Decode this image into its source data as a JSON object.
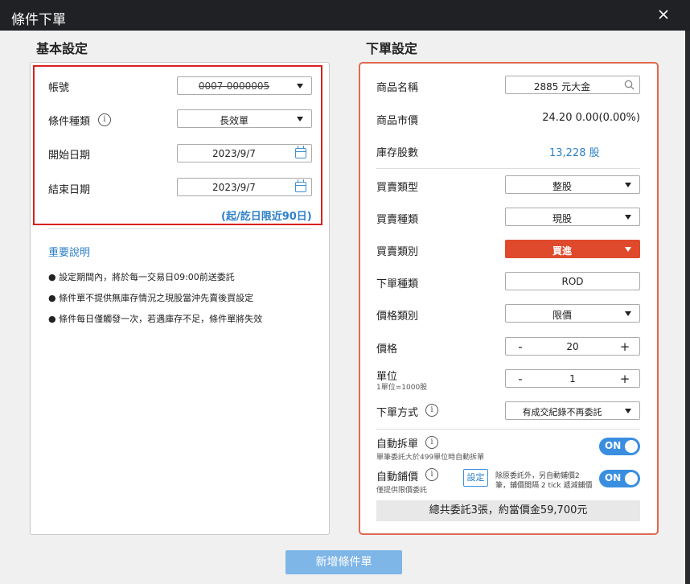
{
  "window": {
    "title": "條件下單"
  },
  "left": {
    "title": "基本設定",
    "account": {
      "label": "帳號",
      "value": "0007-0000005"
    },
    "cond_type": {
      "label": "條件種類",
      "value": "長效單"
    },
    "start": {
      "label": "開始日期",
      "value": "2023/9/7"
    },
    "end": {
      "label": "結束日期",
      "value": "2023/9/7"
    },
    "range_hint": "(起/訖日限近90日)",
    "notes_link": "重要說明",
    "notes": [
      "● 設定期間內，將於每一交易日09:00前送委託",
      "● 條件單不提供無庫存情況之現股當沖先賣後買設定",
      "● 條件每日僅觸發一次，若遇庫存不足，條件單將失效"
    ]
  },
  "right": {
    "title": "下單設定",
    "product": {
      "label": "商品名稱",
      "value": "2885 元大金"
    },
    "market_price": {
      "label": "商品市價",
      "value": "24.20  0.00(0.00%)"
    },
    "stock": {
      "label": "庫存股數",
      "value": "13,228 股"
    },
    "trade_type": {
      "label": "買賣類型",
      "value": "整股"
    },
    "trade_kind": {
      "label": "買賣種類",
      "value": "現股"
    },
    "trade_side": {
      "label": "買賣類別",
      "value": "買進"
    },
    "order_type": {
      "label": "下單種類",
      "value": "ROD"
    },
    "price_type": {
      "label": "價格類別",
      "value": "限價"
    },
    "price": {
      "label": "價格",
      "value": "20",
      "minus": "-",
      "plus": "+"
    },
    "unit": {
      "label": "單位",
      "sub": "1單位=1000股",
      "value": "1",
      "minus": "-",
      "plus": "+"
    },
    "order_method": {
      "label": "下單方式",
      "value": "有成交紀錄不再委託"
    },
    "auto_split": {
      "label": "自動拆單",
      "sub": "單筆委託大於499單位時自動拆單",
      "toggle": "ON"
    },
    "auto_fill": {
      "label": "自動鋪價",
      "sub": "僅提供限價委託",
      "toggle": "ON",
      "set_label": "設定",
      "note_line1": "除原委託外，另自動鋪價2",
      "note_line2": "筆，鋪價間隔 2 tick 遞減鋪價"
    },
    "summary": "總共委託3張，約當價金59,700元"
  },
  "submit_label": "新增條件單",
  "colors": {
    "accent": "#3a8ee0",
    "buy": "#df4a2c",
    "frame": "#d9201e"
  }
}
